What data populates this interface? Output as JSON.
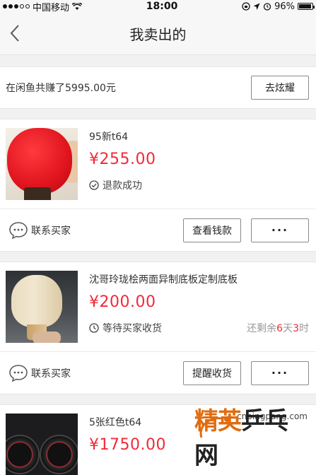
{
  "status_bar": {
    "carrier": "中国移动",
    "time": "18:00",
    "battery": "96%",
    "battery_level": 0.96
  },
  "nav": {
    "title": "我卖出的"
  },
  "earnings": {
    "text": "在闲鱼共赚了5995.00元",
    "button_label": "去炫耀"
  },
  "orders": [
    {
      "title": "95新t64",
      "price": "¥255.00",
      "status": "退款成功",
      "contact_label": "联系买家",
      "action_label": "查看钱款",
      "more_label": "···"
    },
    {
      "title": "沈哥玲珑桧两面异制底板定制底板",
      "price": "¥200.00",
      "status": "等待买家收货",
      "remain_prefix": "还剩余",
      "remain_days": "6",
      "remain_days_unit": "天",
      "remain_hours": "3",
      "remain_hours_unit": "时",
      "contact_label": "联系买家",
      "action_label": "提醒收货",
      "more_label": "···"
    },
    {
      "title": "5张红色t64",
      "price": "¥1750.00"
    }
  ],
  "watermark": {
    "url": "cnpingpang.com",
    "logo_orange": "精英",
    "logo_black": "乒乓网"
  },
  "colors": {
    "price": "#f2293a",
    "watermark": "#e06c10"
  }
}
